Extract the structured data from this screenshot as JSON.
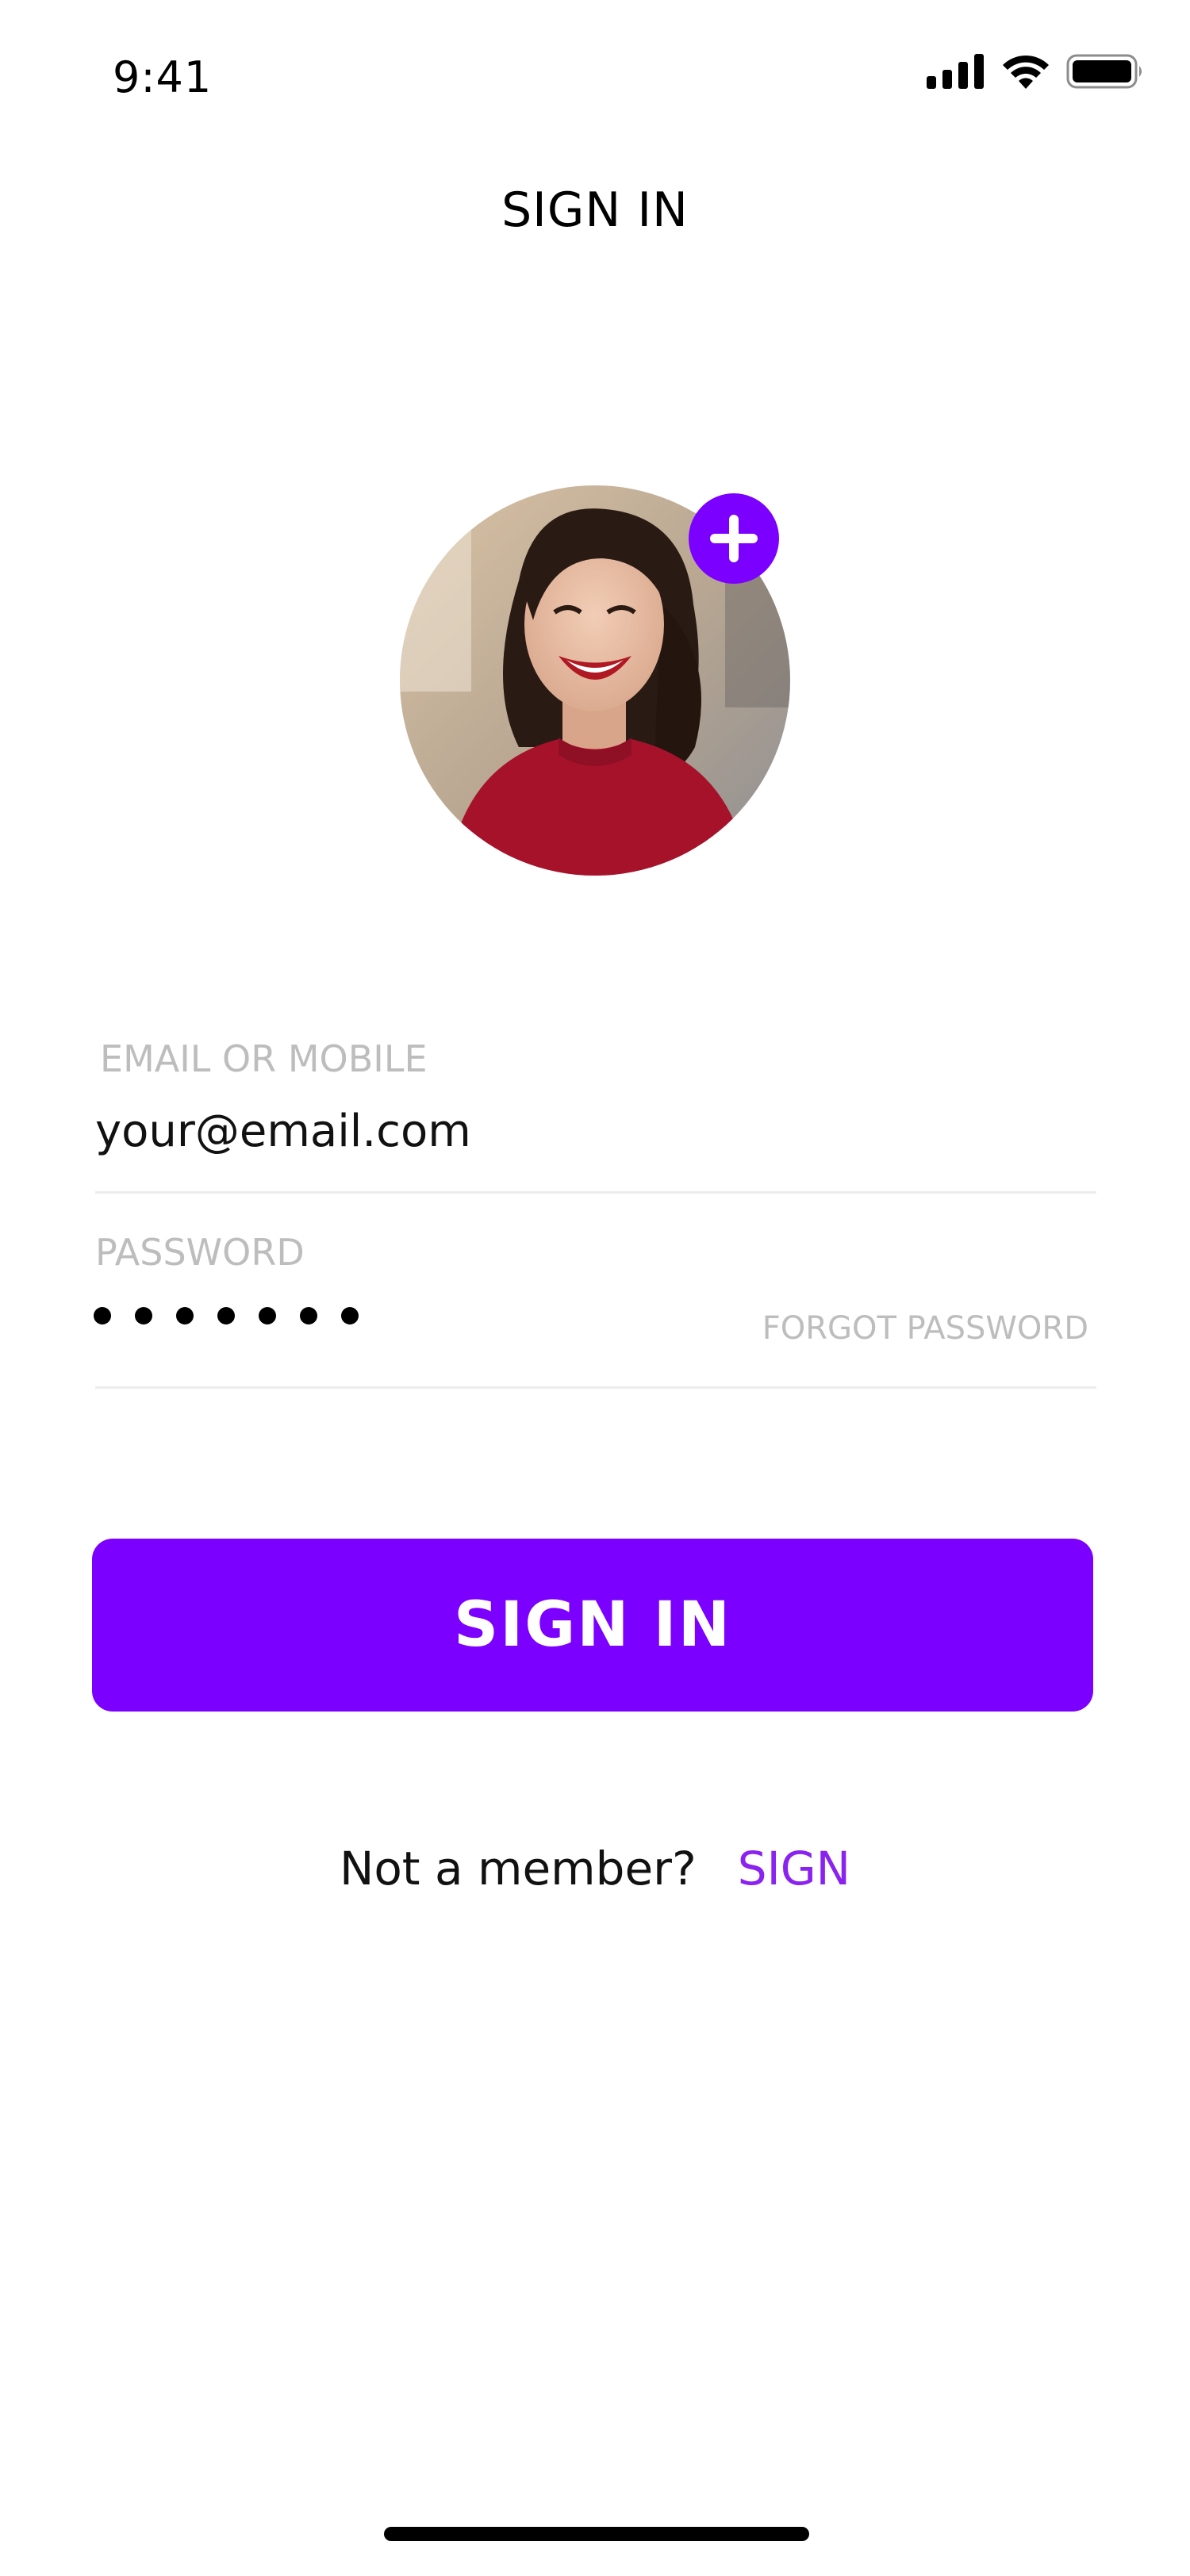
{
  "status_bar": {
    "time": "9:41"
  },
  "header": {
    "title": "SIGN IN"
  },
  "avatar": {
    "icon": "profile-photo",
    "add_icon": "plus-icon"
  },
  "form": {
    "email": {
      "label": "EMAIL OR MOBILE",
      "value": "your@email.com"
    },
    "password": {
      "label": "PASSWORD",
      "masked_length": 7,
      "forgot_label": "FORGOT PASSWORD"
    }
  },
  "primary_button": {
    "label": "SIGN IN"
  },
  "footer": {
    "prompt": "Not a member?",
    "link": "SIGN"
  },
  "colors": {
    "accent": "#7B00FF",
    "link": "#8A22F0",
    "muted": "#BDBDBD",
    "divider": "#EDEDED"
  }
}
